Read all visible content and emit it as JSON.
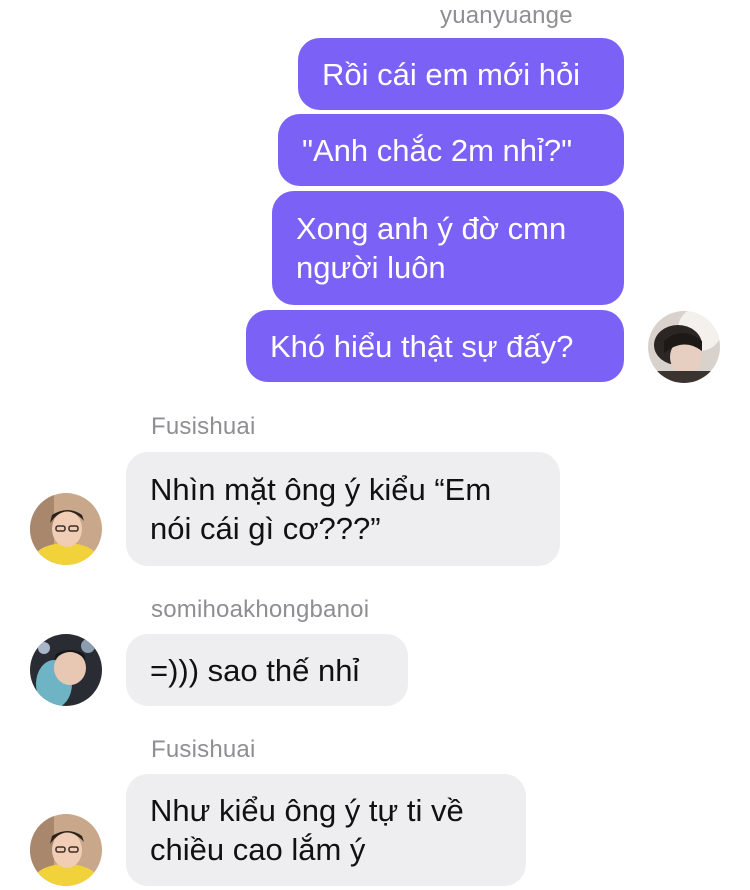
{
  "outgoing": {
    "sender": "yuanyuange",
    "messages": [
      "Rồi cái em mới hỏi",
      "\"Anh chắc 2m nhỉ?\"",
      "Xong anh ý đờ cmn\nngười luôn",
      "Khó hiểu thật sự đấy?"
    ]
  },
  "incoming": [
    {
      "sender": "Fusishuai",
      "message": "Nhìn mặt ông ý kiểu “Em\nnói cái gì cơ???”"
    },
    {
      "sender": "somihoakhongbanoi",
      "message": "=))) sao thế nhỉ"
    },
    {
      "sender": "Fusishuai",
      "message": "Như kiểu ông ý tự ti về\nchiều cao lắm ý"
    }
  ],
  "colors": {
    "outgoing_bubble": "#7b61f5",
    "incoming_bubble": "#eeeef0",
    "sender_name": "#8e8e93"
  }
}
